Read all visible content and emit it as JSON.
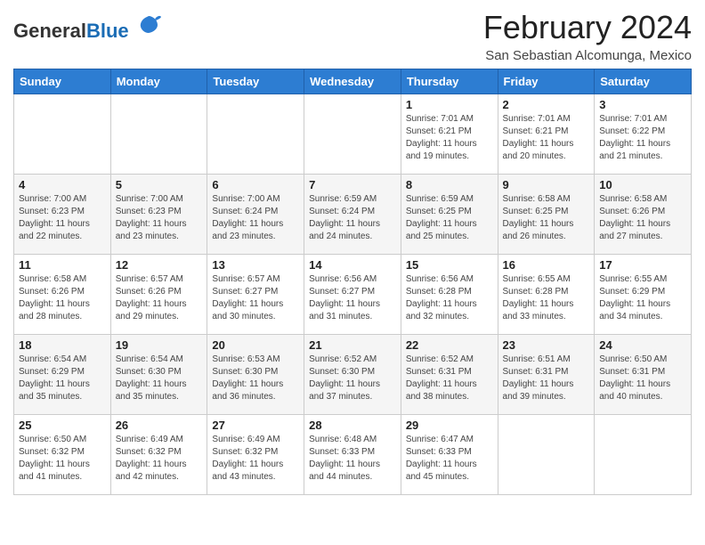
{
  "header": {
    "title": "February 2024",
    "subtitle": "San Sebastian Alcomunga, Mexico",
    "logo_general": "General",
    "logo_blue": "Blue"
  },
  "weekdays": [
    "Sunday",
    "Monday",
    "Tuesday",
    "Wednesday",
    "Thursday",
    "Friday",
    "Saturday"
  ],
  "weeks": [
    [
      {
        "day": "",
        "info": ""
      },
      {
        "day": "",
        "info": ""
      },
      {
        "day": "",
        "info": ""
      },
      {
        "day": "",
        "info": ""
      },
      {
        "day": "1",
        "info": "Sunrise: 7:01 AM\nSunset: 6:21 PM\nDaylight: 11 hours\nand 19 minutes."
      },
      {
        "day": "2",
        "info": "Sunrise: 7:01 AM\nSunset: 6:21 PM\nDaylight: 11 hours\nand 20 minutes."
      },
      {
        "day": "3",
        "info": "Sunrise: 7:01 AM\nSunset: 6:22 PM\nDaylight: 11 hours\nand 21 minutes."
      }
    ],
    [
      {
        "day": "4",
        "info": "Sunrise: 7:00 AM\nSunset: 6:23 PM\nDaylight: 11 hours\nand 22 minutes."
      },
      {
        "day": "5",
        "info": "Sunrise: 7:00 AM\nSunset: 6:23 PM\nDaylight: 11 hours\nand 23 minutes."
      },
      {
        "day": "6",
        "info": "Sunrise: 7:00 AM\nSunset: 6:24 PM\nDaylight: 11 hours\nand 23 minutes."
      },
      {
        "day": "7",
        "info": "Sunrise: 6:59 AM\nSunset: 6:24 PM\nDaylight: 11 hours\nand 24 minutes."
      },
      {
        "day": "8",
        "info": "Sunrise: 6:59 AM\nSunset: 6:25 PM\nDaylight: 11 hours\nand 25 minutes."
      },
      {
        "day": "9",
        "info": "Sunrise: 6:58 AM\nSunset: 6:25 PM\nDaylight: 11 hours\nand 26 minutes."
      },
      {
        "day": "10",
        "info": "Sunrise: 6:58 AM\nSunset: 6:26 PM\nDaylight: 11 hours\nand 27 minutes."
      }
    ],
    [
      {
        "day": "11",
        "info": "Sunrise: 6:58 AM\nSunset: 6:26 PM\nDaylight: 11 hours\nand 28 minutes."
      },
      {
        "day": "12",
        "info": "Sunrise: 6:57 AM\nSunset: 6:26 PM\nDaylight: 11 hours\nand 29 minutes."
      },
      {
        "day": "13",
        "info": "Sunrise: 6:57 AM\nSunset: 6:27 PM\nDaylight: 11 hours\nand 30 minutes."
      },
      {
        "day": "14",
        "info": "Sunrise: 6:56 AM\nSunset: 6:27 PM\nDaylight: 11 hours\nand 31 minutes."
      },
      {
        "day": "15",
        "info": "Sunrise: 6:56 AM\nSunset: 6:28 PM\nDaylight: 11 hours\nand 32 minutes."
      },
      {
        "day": "16",
        "info": "Sunrise: 6:55 AM\nSunset: 6:28 PM\nDaylight: 11 hours\nand 33 minutes."
      },
      {
        "day": "17",
        "info": "Sunrise: 6:55 AM\nSunset: 6:29 PM\nDaylight: 11 hours\nand 34 minutes."
      }
    ],
    [
      {
        "day": "18",
        "info": "Sunrise: 6:54 AM\nSunset: 6:29 PM\nDaylight: 11 hours\nand 35 minutes."
      },
      {
        "day": "19",
        "info": "Sunrise: 6:54 AM\nSunset: 6:30 PM\nDaylight: 11 hours\nand 35 minutes."
      },
      {
        "day": "20",
        "info": "Sunrise: 6:53 AM\nSunset: 6:30 PM\nDaylight: 11 hours\nand 36 minutes."
      },
      {
        "day": "21",
        "info": "Sunrise: 6:52 AM\nSunset: 6:30 PM\nDaylight: 11 hours\nand 37 minutes."
      },
      {
        "day": "22",
        "info": "Sunrise: 6:52 AM\nSunset: 6:31 PM\nDaylight: 11 hours\nand 38 minutes."
      },
      {
        "day": "23",
        "info": "Sunrise: 6:51 AM\nSunset: 6:31 PM\nDaylight: 11 hours\nand 39 minutes."
      },
      {
        "day": "24",
        "info": "Sunrise: 6:50 AM\nSunset: 6:31 PM\nDaylight: 11 hours\nand 40 minutes."
      }
    ],
    [
      {
        "day": "25",
        "info": "Sunrise: 6:50 AM\nSunset: 6:32 PM\nDaylight: 11 hours\nand 41 minutes."
      },
      {
        "day": "26",
        "info": "Sunrise: 6:49 AM\nSunset: 6:32 PM\nDaylight: 11 hours\nand 42 minutes."
      },
      {
        "day": "27",
        "info": "Sunrise: 6:49 AM\nSunset: 6:32 PM\nDaylight: 11 hours\nand 43 minutes."
      },
      {
        "day": "28",
        "info": "Sunrise: 6:48 AM\nSunset: 6:33 PM\nDaylight: 11 hours\nand 44 minutes."
      },
      {
        "day": "29",
        "info": "Sunrise: 6:47 AM\nSunset: 6:33 PM\nDaylight: 11 hours\nand 45 minutes."
      },
      {
        "day": "",
        "info": ""
      },
      {
        "day": "",
        "info": ""
      }
    ]
  ]
}
